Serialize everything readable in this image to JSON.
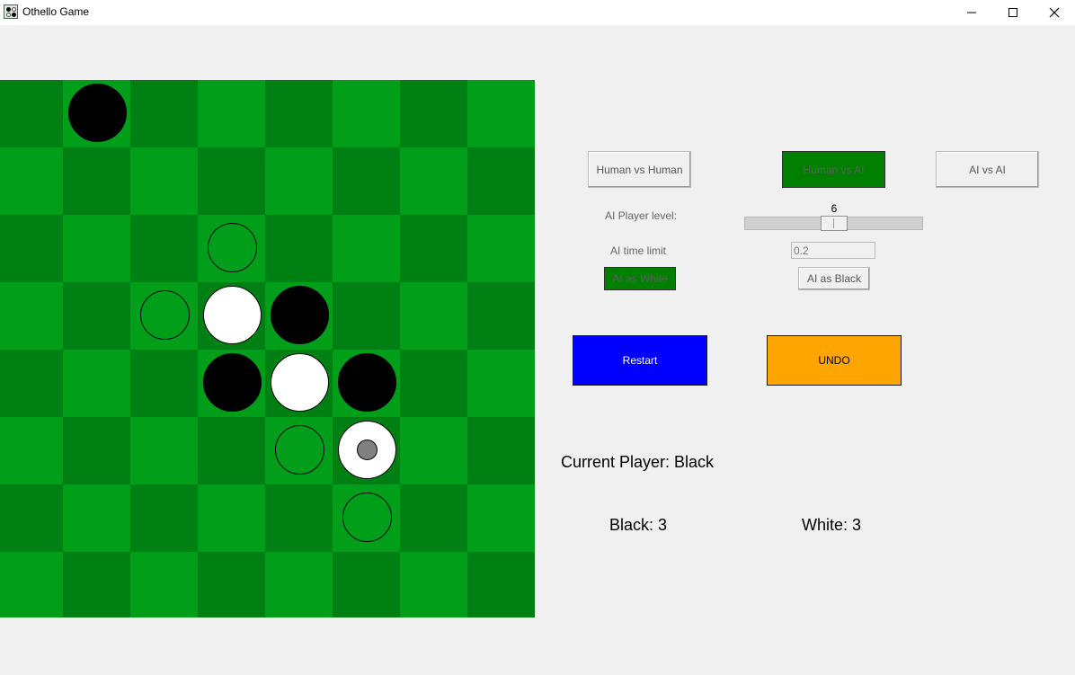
{
  "window": {
    "title": "Othello Game",
    "app_icon": "othello-board-icon",
    "controls": [
      "minimize-icon",
      "maximize-icon",
      "close-icon"
    ]
  },
  "colors": {
    "board_light": "#009e19",
    "board_dark": "#008012",
    "black_disc": "#000000",
    "white_disc": "#ffffff",
    "selected_button": "#007f00",
    "restart_button": "#0000ff",
    "undo_button": "#ffa500"
  },
  "board": {
    "size": 8,
    "cells": [
      [
        ".",
        "B",
        ".",
        ".",
        ".",
        ".",
        ".",
        "."
      ],
      [
        ".",
        ".",
        ".",
        ".",
        ".",
        ".",
        ".",
        "."
      ],
      [
        ".",
        ".",
        ".",
        "h",
        ".",
        ".",
        ".",
        "."
      ],
      [
        ".",
        ".",
        "h",
        "W",
        "B",
        ".",
        ".",
        "."
      ],
      [
        ".",
        ".",
        ".",
        "B",
        "W",
        "B",
        ".",
        "."
      ],
      [
        ".",
        ".",
        ".",
        ".",
        "h",
        "L",
        ".",
        "."
      ],
      [
        ".",
        ".",
        ".",
        ".",
        ".",
        "h",
        ".",
        "."
      ],
      [
        ".",
        ".",
        ".",
        ".",
        ".",
        ".",
        ".",
        "."
      ]
    ],
    "legend": {
      "B": "black",
      "W": "white",
      "h": "valid-move hint",
      "L": "last move (white)"
    }
  },
  "modes": {
    "human_vs_human": "Human vs Human",
    "human_vs_ai": "Human vs AI",
    "ai_vs_ai": "AI vs AI",
    "selected": "human_vs_ai"
  },
  "ai": {
    "level_label": "AI Player level:",
    "level_value": "6",
    "level_min": 1,
    "level_max": 12,
    "time_label": "AI time limit",
    "time_value": "0.2",
    "as_white": "AI as White",
    "as_black": "AI as Black",
    "selected_side": "white"
  },
  "actions": {
    "restart": "Restart",
    "undo": "UNDO"
  },
  "status": {
    "current_player": "Current Player: Black",
    "black_score": "Black: 3",
    "white_score": "White: 3"
  }
}
